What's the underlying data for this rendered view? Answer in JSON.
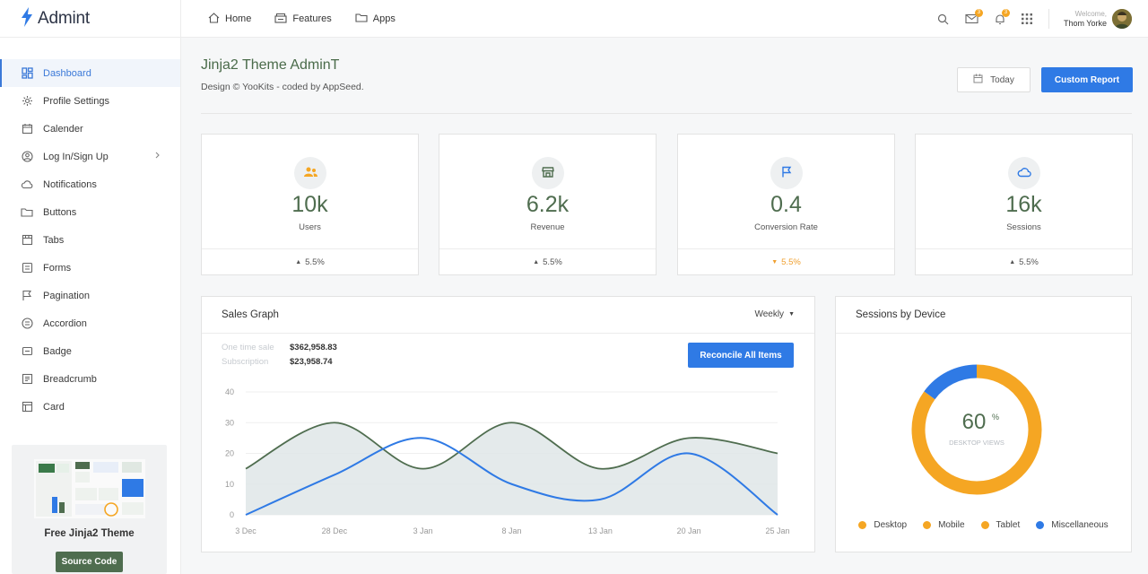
{
  "brand": {
    "name": "Admint"
  },
  "sidebar": {
    "items": [
      {
        "label": "Dashboard",
        "icon": "dashboard-icon"
      },
      {
        "label": "Profile Settings",
        "icon": "gear-icon"
      },
      {
        "label": "Calender",
        "icon": "calendar-icon"
      },
      {
        "label": "Log In/Sign Up",
        "icon": "user-icon"
      },
      {
        "label": "Notifications",
        "icon": "cloud-icon"
      },
      {
        "label": "Buttons",
        "icon": "folder-icon"
      },
      {
        "label": "Tabs",
        "icon": "tabs-icon"
      },
      {
        "label": "Forms",
        "icon": "forms-icon"
      },
      {
        "label": "Pagination",
        "icon": "flag-icon"
      },
      {
        "label": "Accordion",
        "icon": "list-icon"
      },
      {
        "label": "Badge",
        "icon": "badge-icon"
      },
      {
        "label": "Breadcrumb",
        "icon": "breadcrumb-icon"
      },
      {
        "label": "Card",
        "icon": "card-icon"
      }
    ],
    "promo": {
      "title": "Free Jinja2 Theme",
      "button": "Source Code"
    }
  },
  "topnav": {
    "items": [
      {
        "label": "Home",
        "icon": "home-icon"
      },
      {
        "label": "Features",
        "icon": "features-icon"
      },
      {
        "label": "Apps",
        "icon": "folder-icon"
      }
    ],
    "badges": {
      "mail": "3",
      "bell": "3"
    },
    "user": {
      "welcome": "Welcome,",
      "name": "Thom Yorke"
    }
  },
  "header": {
    "title": "Jinja2 Theme AdminT",
    "subtitle": "Design © YooKits - coded by AppSeed.",
    "today_label": "Today",
    "report_label": "Custom Report"
  },
  "stats": [
    {
      "value": "10k",
      "label": "Users",
      "change": "5.5%",
      "trend": "up",
      "icon": "users-icon",
      "icon_color": "#f5a623"
    },
    {
      "value": "6.2k",
      "label": "Revenue",
      "change": "5.5%",
      "trend": "up",
      "icon": "store-icon",
      "icon_color": "#4f6d4f"
    },
    {
      "value": "0.4",
      "label": "Conversion Rate",
      "change": "5.5%",
      "trend": "down",
      "icon": "flag-icon",
      "icon_color": "#2f7ae5"
    },
    {
      "value": "16k",
      "label": "Sessions",
      "change": "5.5%",
      "trend": "up",
      "icon": "cloud-icon",
      "icon_color": "#2f7ae5"
    }
  ],
  "sales": {
    "title": "Sales Graph",
    "period": "Weekly",
    "one_time_label": "One time sale",
    "one_time_value": "$362,958.83",
    "subscription_label": "Subscription",
    "subscription_value": "$23,958.74",
    "action_label": "Reconcile All Items"
  },
  "device": {
    "title": "Sessions by Device",
    "center_value": "60",
    "center_unit": "%",
    "center_label": "DESKTOP VIEWS",
    "legend": [
      {
        "name": "Desktop",
        "color": "#f5a623"
      },
      {
        "name": "Mobile",
        "color": "#f5a623"
      },
      {
        "name": "Tablet",
        "color": "#f5a623"
      },
      {
        "name": "Miscellaneous",
        "color": "#2f7ae5"
      }
    ]
  },
  "colors": {
    "accent": "#2f7ae5",
    "brand_green": "#4f6d4f",
    "warning": "#f5a623"
  },
  "chart_data": [
    {
      "type": "area",
      "x": [
        "3 Dec",
        "28 Dec",
        "3 Jan",
        "8 Jan",
        "13 Jan",
        "20 Jan",
        "25 Jan"
      ],
      "ylim": [
        0,
        40
      ],
      "yticks": [
        0,
        10,
        20,
        30,
        40
      ],
      "series": [
        {
          "values": [
            15,
            30,
            15,
            30,
            15,
            25,
            20
          ],
          "color": "#4f6d4f"
        },
        {
          "values": [
            0,
            13,
            25,
            10,
            5,
            20,
            0
          ],
          "color": "#2f7ae5"
        }
      ]
    },
    {
      "type": "pie",
      "labels": [
        "Desktop",
        "Miscellaneous"
      ],
      "values": [
        85,
        15
      ],
      "colors": [
        "#f5a623",
        "#2f7ae5"
      ]
    }
  ]
}
